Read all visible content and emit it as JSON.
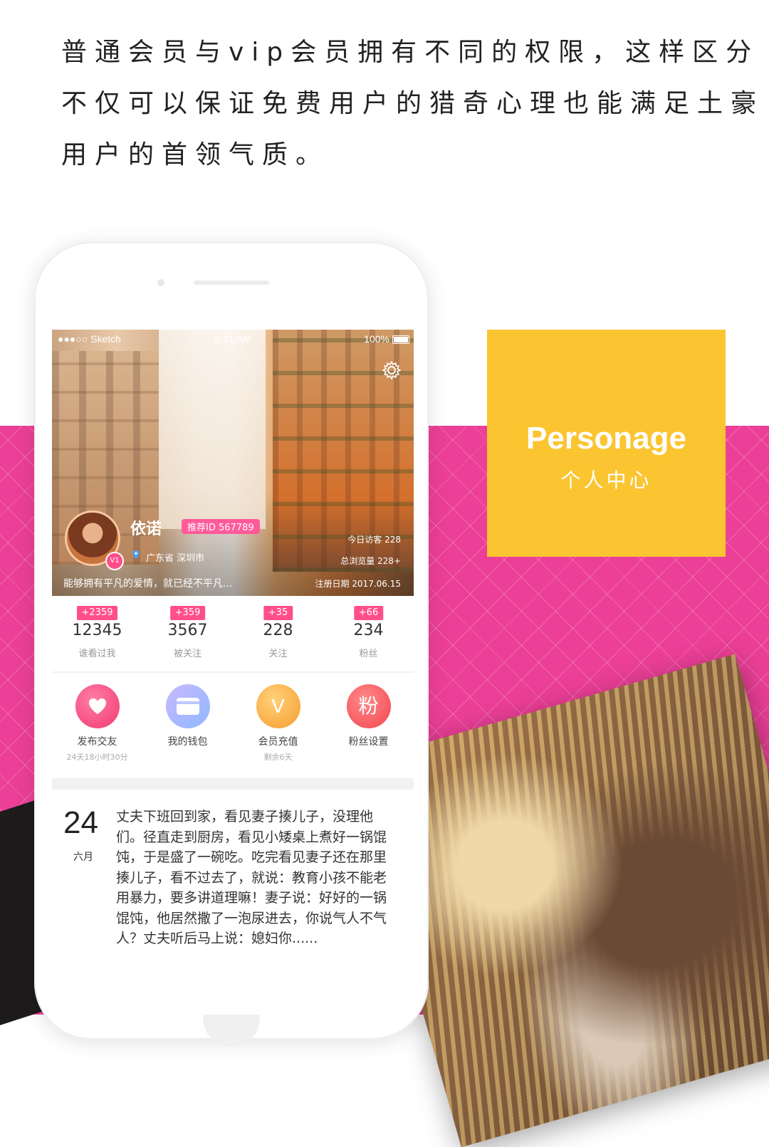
{
  "intro": {
    "line1": "普通会员与vip会员拥有不同的权限，这样区分",
    "line2": "不仅可以保证免费用户的猎奇心理也能满足土豪",
    "line3": "用户的首领气质。"
  },
  "tag": {
    "title": "Personage",
    "subtitle": "个人中心"
  },
  "colors": {
    "pink": "#ec3f97",
    "yellow": "#fbc531",
    "badge": "#ff4f8b"
  },
  "status_bar": {
    "carrier": "●●●○○ Sketch",
    "time": "9:41 AM",
    "battery": "100%"
  },
  "profile": {
    "avatar_badge": "V1",
    "nickname": "依诺",
    "recommend_id": "推荐ID 567789",
    "location": "广东省 深圳市",
    "motto": "能够拥有平凡的爱情，就已经不平凡...",
    "today_visitors": "今日访客  228",
    "total_views": "总浏览量  228+",
    "register_date": "注册日期    2017.06.15"
  },
  "stats": [
    {
      "badge": "+2359",
      "value": "12345",
      "label": "谁看过我"
    },
    {
      "badge": "+359",
      "value": "3567",
      "label": "被关注"
    },
    {
      "badge": "+35",
      "value": "228",
      "label": "关注"
    },
    {
      "badge": "+66",
      "value": "234",
      "label": "粉丝"
    }
  ],
  "actions": [
    {
      "icon": "heart-icon",
      "label": "发布交友",
      "sub": "24天18小时30分"
    },
    {
      "icon": "wallet-icon",
      "label": "我的钱包",
      "sub": ""
    },
    {
      "icon": "vip-v-icon",
      "glyph": "V",
      "label": "会员充值",
      "sub": "剩余6天"
    },
    {
      "icon": "fans-icon",
      "glyph": "粉",
      "label": "粉丝设置",
      "sub": ""
    }
  ],
  "post": {
    "day": "24",
    "month": "六月",
    "text": "丈夫下班回到家，看见妻子揍儿子，没理他们。径直走到厨房，看见小矮桌上煮好一锅馄饨，于是盛了一碗吃。吃完看见妻子还在那里揍儿子，看不过去了，就说：教育小孩不能老用暴力，要多讲道理嘛！妻子说：好好的一锅馄饨，他居然撒了一泡尿进去，你说气人不气人？丈夫听后马上说：媳妇你......"
  }
}
